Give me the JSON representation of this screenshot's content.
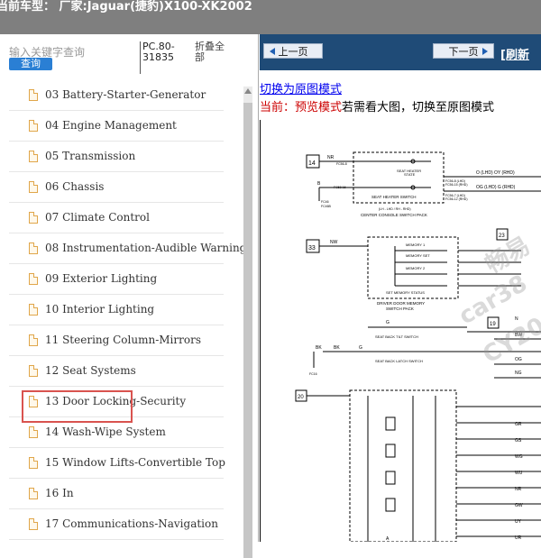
{
  "top": {
    "title": "当前车型： 厂家:Jaguar(捷豹)X100-XK2002"
  },
  "search": {
    "placeholder": "输入关键字查询",
    "query_button": "查询",
    "pc_code": "PC.80-31835",
    "fold_all": "折叠全部"
  },
  "tree": {
    "items": [
      {
        "label": "03 Battery-Starter-Generator"
      },
      {
        "label": "04 Engine Management"
      },
      {
        "label": "05 Transmission"
      },
      {
        "label": "06 Chassis"
      },
      {
        "label": "07 Climate Control"
      },
      {
        "label": "08 Instrumentation-Audible Warnings"
      },
      {
        "label": "09 Exterior Lighting"
      },
      {
        "label": "10 Interior Lighting"
      },
      {
        "label": "11 Steering Column-Mirrors"
      },
      {
        "label": "12 Seat Systems"
      },
      {
        "label": "13 Door Locking-Security"
      },
      {
        "label": "14 Wash-Wipe System"
      },
      {
        "label": "15 Window Lifts-Convertible Top"
      },
      {
        "label": "16 In"
      },
      {
        "label": "17 Communications-Navigation"
      }
    ],
    "selected_index": 9
  },
  "viewer": {
    "prev_button": "上一页",
    "next_button": "下一页",
    "refresh_link": "[刷新",
    "switch_link": "切换为原图模式",
    "status_prefix": "当前：",
    "status_mode": "预览模式",
    "status_tail": "若需看大图，切换至原图模式"
  },
  "diagram": {
    "labels": {
      "c14": "14",
      "nr": "NR",
      "fc": "FC56-8",
      "seat_heater": "SEAT HEATER",
      "state": "STATE",
      "b": "B",
      "fc58": "FC58-16",
      "fc46": "FC46",
      "fc46b": "FC46B",
      "heater_switch": "SEAT HEATER SWITCH",
      "lhd_rhd": "(LH - LHD / RH - RHD)",
      "console": "CENTER CONSOLE SWITCH PACK",
      "olhd": "O (LHD)  OY (RHD)",
      "oglhd": "OG (LHD)  G (RHD)",
      "fcr": "FC56-8 (LHD)",
      "fcr2": "FC56-15 (RHD)",
      "fcr3": "FC56-7 (LHD)",
      "fcr4": "FC56-12 (RHD)",
      "c33": "33",
      "nw": "NW",
      "m1": "MEMORY 1",
      "mset": "MEMORY SET",
      "m2": "MEMORY 2",
      "mstatus": "SET MEMORY STATUS",
      "ddm": "DRIVER DOOR MEMORY",
      "swpack": "SWITCH PACK",
      "c23": "23",
      "c19": "19",
      "sbt": "SEAT BACK TILT SWITCH",
      "sbl": "SEAT BACK LATCH SWITCH",
      "g": "G",
      "bk": "BK",
      "fc16": "FC16",
      "c20": "20",
      "seat_unit": "SEAT CONTROL",
      "w1": "BW",
      "w2": "OG",
      "w3": "NG",
      "w4": "N",
      "w5": "GR",
      "w6": "GS",
      "w7": "WG",
      "w8": "WU",
      "w9": "NR",
      "w10": "GW",
      "w11": "UY",
      "w12": "UR",
      "w13": "A"
    }
  },
  "watermark": {
    "w1": "畅易",
    "w2": "car38",
    "w3": "CY20"
  }
}
